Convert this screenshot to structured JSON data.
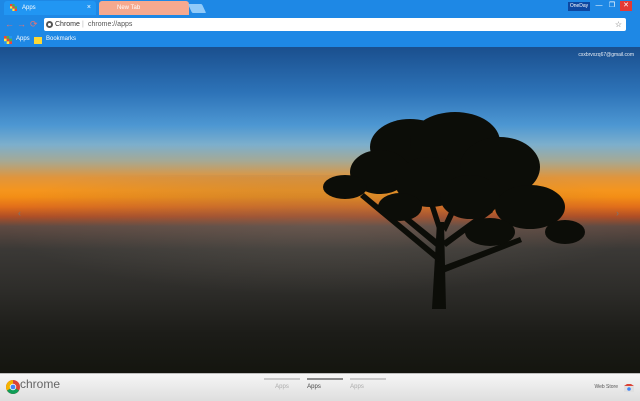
{
  "tabs": [
    {
      "label": "Apps",
      "close": "×"
    },
    {
      "label": "New Tab"
    }
  ],
  "window": {
    "user": "OneDay",
    "minimize": "—",
    "restore": "❐",
    "close": "✕"
  },
  "toolbar": {
    "back": "←",
    "forward": "→",
    "reload": "⟳"
  },
  "omnibox": {
    "label": "Chrome",
    "separator": "|",
    "url": "chrome://apps",
    "star": "☆"
  },
  "bookmarks": [
    {
      "label": "Apps",
      "icon": "apps-grid-icon"
    },
    {
      "label": "Bookmarks",
      "icon": "folder-icon"
    }
  ],
  "account": {
    "email": "csxbrvxzq67@gmail.com"
  },
  "page_arrows": {
    "left": "‹",
    "right": "›"
  },
  "bottom": {
    "brand": "chrome",
    "pages": [
      "Apps",
      "Apps",
      "Apps"
    ],
    "active_page": 1,
    "web_store": "Web Store"
  }
}
